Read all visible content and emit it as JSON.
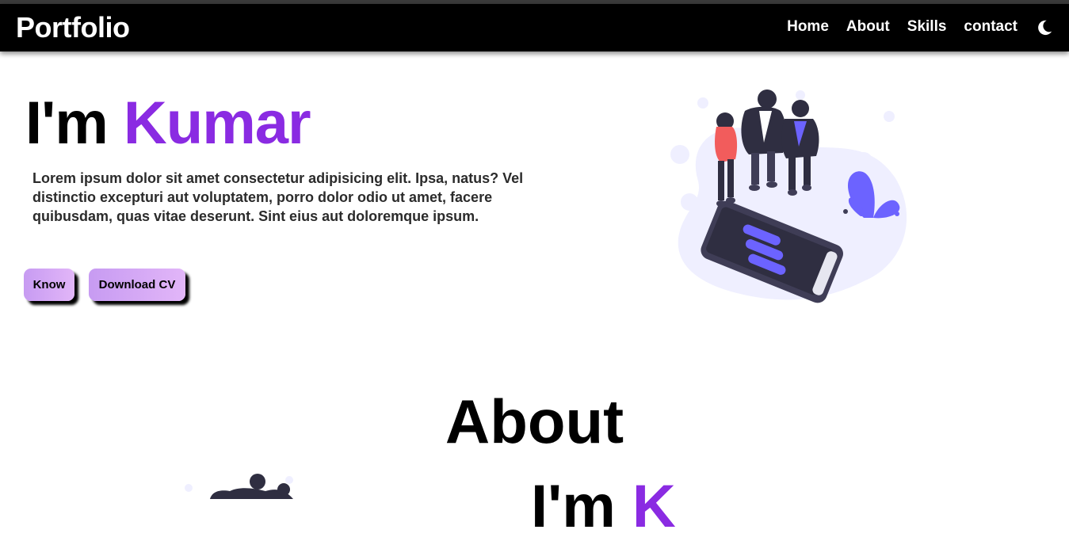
{
  "navbar": {
    "brand": "Portfolio",
    "links": [
      "Home",
      "About",
      "Skills",
      "contact"
    ],
    "theme_icon": "moon-icon"
  },
  "hero": {
    "greeting": "I'm",
    "name": "Kumar",
    "description": "Lorem ipsum dolor sit amet consectetur adipisicing elit. Ipsa, natus? Vel distinctio excepturi aut voluptatem, porro dolor odio ut amet, facere quibusdam, quas vitae deserunt. Sint eius aut doloremque ipsum.",
    "buttons": {
      "know": "Know",
      "download": "Download CV"
    },
    "illustration": "team-with-phone-illustration"
  },
  "about": {
    "heading": "About",
    "sub_greeting": "I'm",
    "sub_name": "K",
    "illustration": "team-illustration"
  },
  "colors": {
    "accent": "#8a2be2",
    "navbar_bg": "#000000",
    "button_gradient_start": "#c79bf2",
    "button_gradient_end": "#e2b6f8",
    "illustration_blob": "#efefff",
    "illustration_purple": "#6c63ff"
  }
}
